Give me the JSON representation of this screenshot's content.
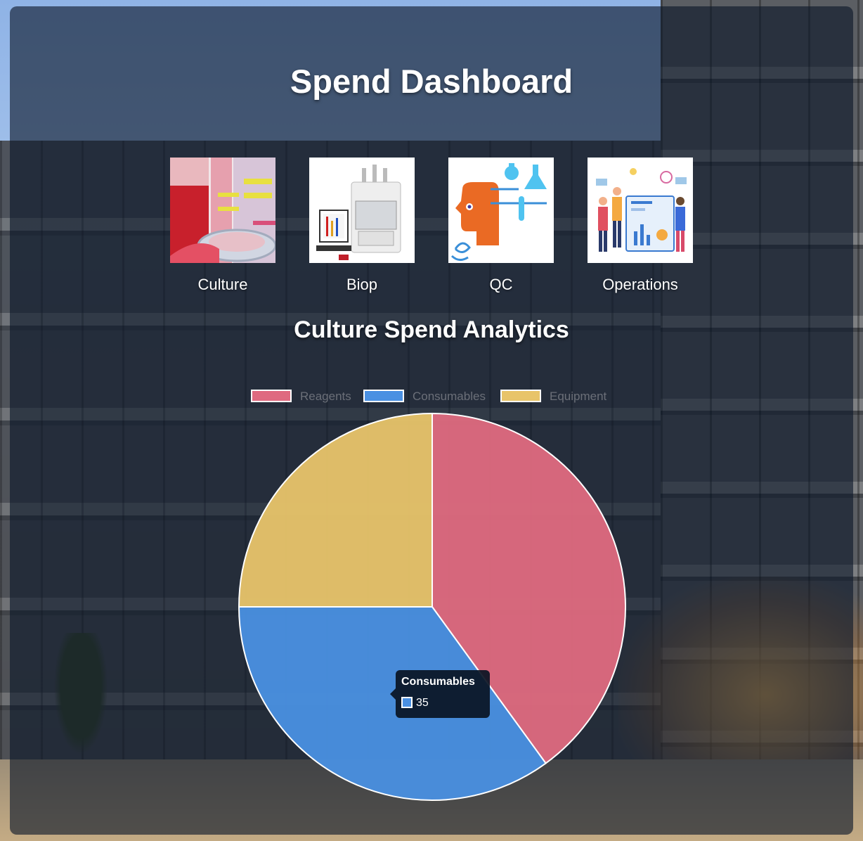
{
  "page": {
    "title": "Spend Dashboard",
    "subtitle": "Culture Spend Analytics"
  },
  "categories": [
    {
      "label": "Culture",
      "icon": "petri-dish-culture-image"
    },
    {
      "label": "Biop",
      "icon": "lab-instrument-image"
    },
    {
      "label": "QC",
      "icon": "head-with-flasks-image"
    },
    {
      "label": "Operations",
      "icon": "team-dashboard-image"
    }
  ],
  "chart_data": {
    "type": "pie",
    "title": "",
    "categories": [
      "Reagents",
      "Consumables",
      "Equipment"
    ],
    "values": [
      40,
      35,
      25
    ],
    "colors": [
      "#df6a80",
      "#4a90e2",
      "#e8c46a"
    ],
    "legend_position": "top"
  },
  "tooltip": {
    "title": "Consumables",
    "value": "35",
    "color": "#4a90e2"
  }
}
